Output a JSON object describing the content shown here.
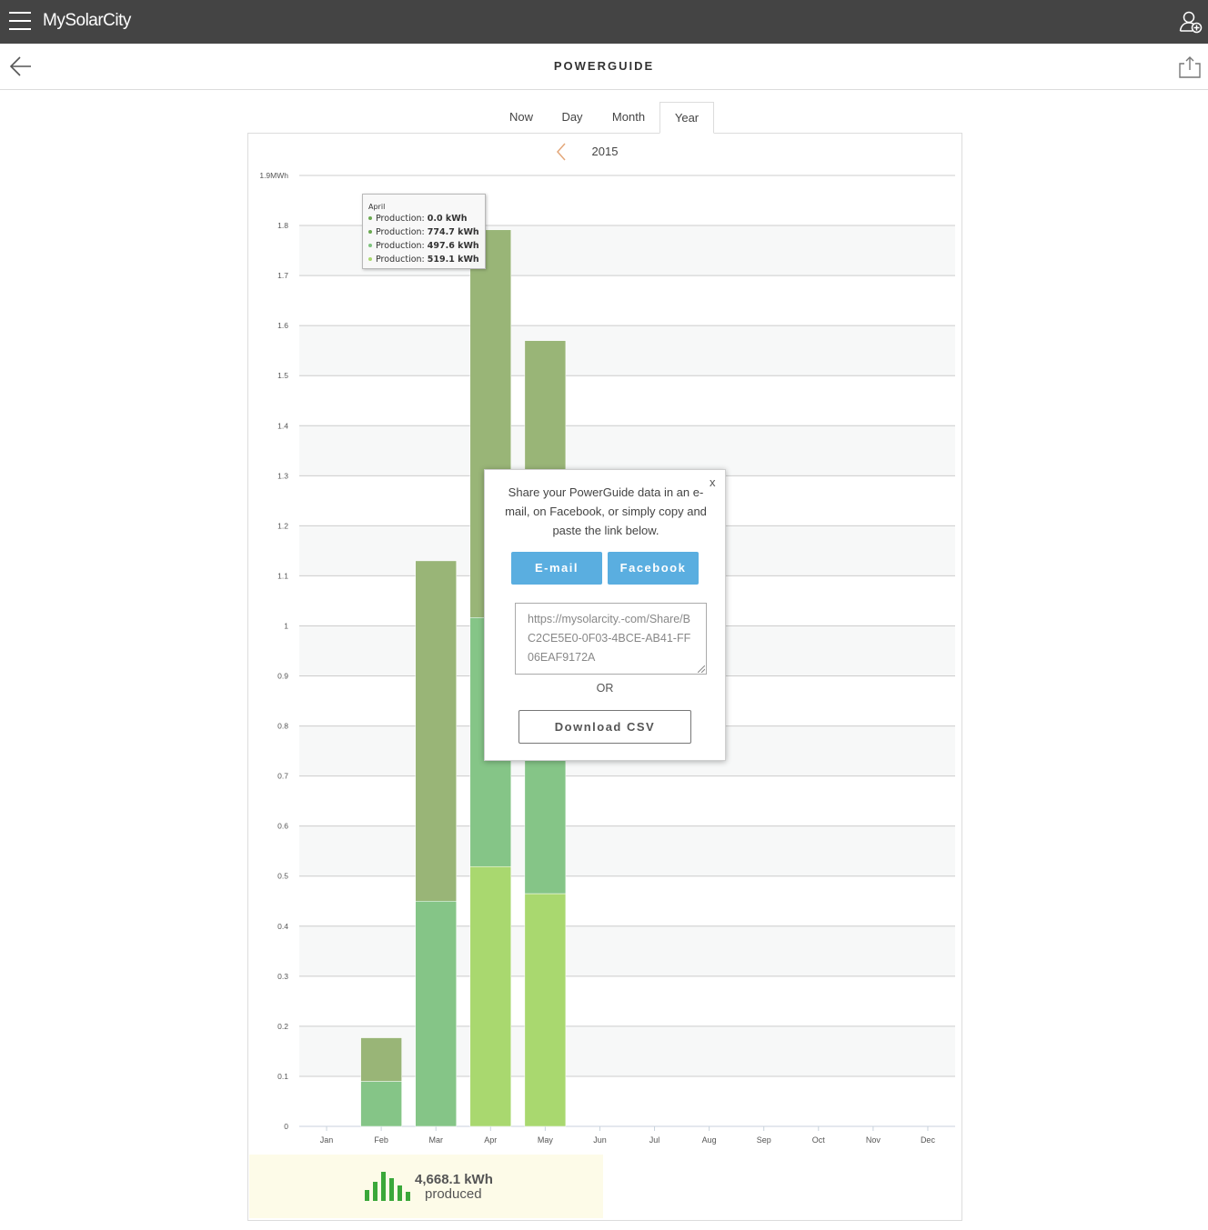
{
  "app": {
    "brand": "MySolarCity"
  },
  "header": {
    "title": "POWERGUIDE"
  },
  "tabs": [
    {
      "label": "Now",
      "active": false
    },
    {
      "label": "Day",
      "active": false
    },
    {
      "label": "Month",
      "active": false
    },
    {
      "label": "Year",
      "active": true
    }
  ],
  "period": {
    "year": "2015"
  },
  "tooltip": {
    "title": "April",
    "rows": [
      {
        "label": "Production:",
        "value": "0.0 kWh",
        "color": "#6aa84f"
      },
      {
        "label": "Production:",
        "value": "774.7 kWh",
        "color": "#6aa84f"
      },
      {
        "label": "Production:",
        "value": "497.6 kWh",
        "color": "#7ec37e"
      },
      {
        "label": "Production:",
        "value": "519.1 kWh",
        "color": "#a9d86f"
      }
    ]
  },
  "summary": {
    "value": "4,668.1 kWh",
    "label": "produced"
  },
  "share_dialog": {
    "close": "x",
    "message": "Share your PowerGuide data in an e-mail, on Facebook, or simply copy and paste the link below.",
    "email_button": "E-mail",
    "facebook_button": "Facebook",
    "link": "https://mysolarcity.-com/Share/BC2CE5E0-0F03-4BCE-AB41-FF06EAF9172A",
    "or": "OR",
    "csv_button": "Download CSV"
  },
  "chart_data": {
    "type": "bar",
    "stacked": true,
    "categories": [
      "Jan",
      "Feb",
      "Mar",
      "Apr",
      "May",
      "Jun",
      "Jul",
      "Aug",
      "Sep",
      "Oct",
      "Nov",
      "Dec"
    ],
    "series": [
      {
        "values": [
          0,
          0.09,
          0.45,
          0.5191,
          0.465,
          0,
          0,
          0,
          0,
          0,
          0,
          0
        ],
        "color": "#a9d86f"
      },
      {
        "values": [
          0,
          0,
          0,
          0.4976,
          0.5,
          0,
          0,
          0,
          0,
          0,
          0,
          0
        ],
        "color": "#85c587"
      },
      {
        "values": [
          0,
          0.087,
          0.68,
          0.7747,
          0.605,
          0,
          0,
          0,
          0,
          0,
          0,
          0
        ],
        "color": "#99b577"
      }
    ],
    "base_series_color_lower": "#85c587",
    "yticks": [
      "0",
      "0.1",
      "0.2",
      "0.3",
      "0.4",
      "0.5",
      "0.6",
      "0.7",
      "0.8",
      "0.9",
      "1",
      "1.1",
      "1.2",
      "1.3",
      "1.4",
      "1.5",
      "1.6",
      "1.7",
      "1.8",
      "1.9MWh"
    ],
    "ylim": [
      0,
      1.9
    ],
    "grid": true
  }
}
